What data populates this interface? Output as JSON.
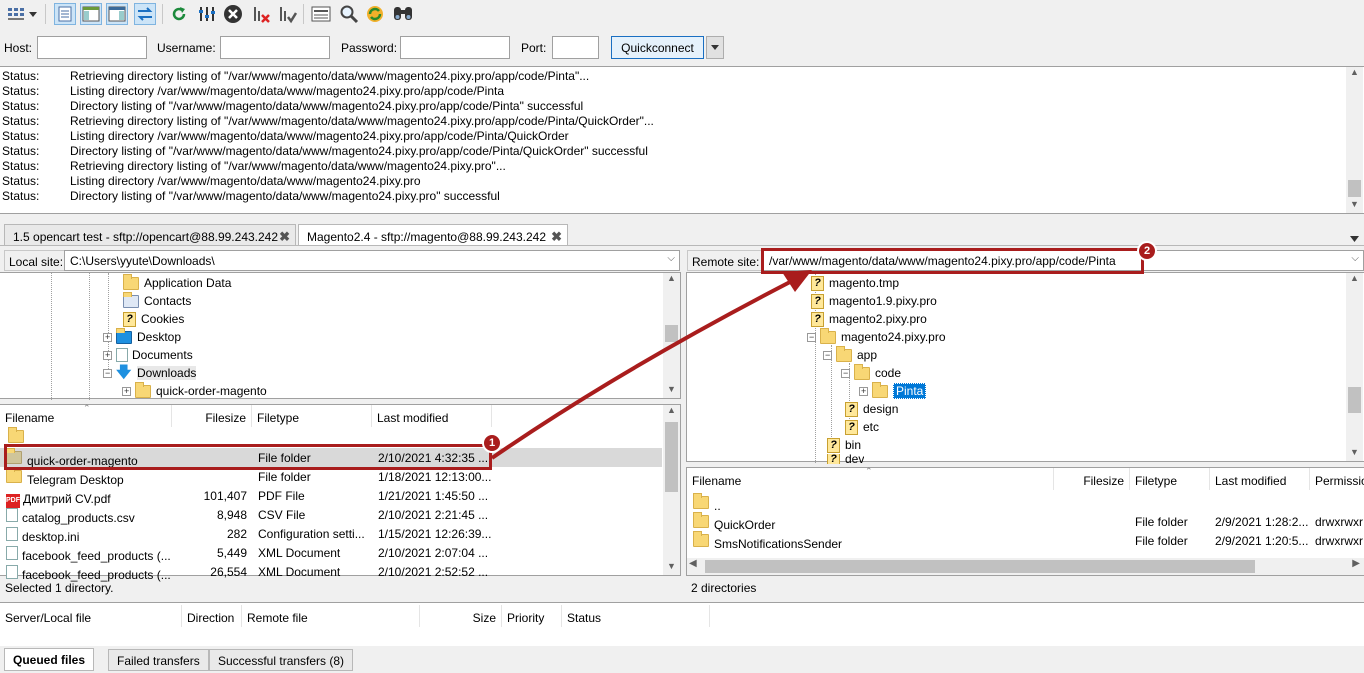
{
  "toolbar": {
    "icons": [
      "site-manager-icon",
      "dropdown-arrow-icon",
      "toggle-message-log-icon",
      "toggle-local-tree-icon",
      "toggle-remote-tree-icon",
      "toggle-queue-icon",
      "refresh-icon",
      "process-queue-icon",
      "cancel-icon",
      "disconnect-icon",
      "reconnect-icon",
      "directory-filter-icon",
      "search-icon",
      "sync-browse-icon",
      "compare-icon"
    ]
  },
  "quickconnect": {
    "host_label": "Host:",
    "username_label": "Username:",
    "password_label": "Password:",
    "port_label": "Port:",
    "host_value": "",
    "username_value": "",
    "password_value": "",
    "port_value": "",
    "button_label": "Quickconnect"
  },
  "message_log": [
    {
      "k": "Status:",
      "v": "Retrieving directory listing of \"/var/www/magento/data/www/magento24.pixy.pro/app/code/Pinta\"..."
    },
    {
      "k": "Status:",
      "v": "Listing directory /var/www/magento/data/www/magento24.pixy.pro/app/code/Pinta"
    },
    {
      "k": "Status:",
      "v": "Directory listing of \"/var/www/magento/data/www/magento24.pixy.pro/app/code/Pinta\" successful"
    },
    {
      "k": "Status:",
      "v": "Retrieving directory listing of \"/var/www/magento/data/www/magento24.pixy.pro/app/code/Pinta/QuickOrder\"..."
    },
    {
      "k": "Status:",
      "v": "Listing directory /var/www/magento/data/www/magento24.pixy.pro/app/code/Pinta/QuickOrder"
    },
    {
      "k": "Status:",
      "v": "Directory listing of \"/var/www/magento/data/www/magento24.pixy.pro/app/code/Pinta/QuickOrder\" successful"
    },
    {
      "k": "Status:",
      "v": "Retrieving directory listing of \"/var/www/magento/data/www/magento24.pixy.pro\"..."
    },
    {
      "k": "Status:",
      "v": "Listing directory /var/www/magento/data/www/magento24.pixy.pro"
    },
    {
      "k": "Status:",
      "v": "Directory listing of \"/var/www/magento/data/www/magento24.pixy.pro\" successful"
    }
  ],
  "tabs": [
    {
      "label": "1.5 opencart test - sftp://opencart@88.99.243.242"
    },
    {
      "label": "Magento2.4 - sftp://magento@88.99.243.242"
    }
  ],
  "local": {
    "site_label": "Local site:",
    "site_path": "C:\\Users\\yyute\\Downloads\\",
    "tree": [
      "Application Data",
      "Contacts",
      "Cookies",
      "Desktop",
      "Documents",
      "Downloads",
      "quick-order-magento"
    ],
    "headers": {
      "name": "Filename",
      "size": "Filesize",
      "type": "Filetype",
      "modified": "Last modified"
    },
    "files": [
      {
        "name": "quick-order-magento",
        "size": "",
        "type": "File folder",
        "modified": "2/10/2021 4:32:35 ..."
      },
      {
        "name": "Telegram Desktop",
        "size": "",
        "type": "File folder",
        "modified": "1/18/2021 12:13:00..."
      },
      {
        "name": "Дмитрий CV.pdf",
        "size": "101,407",
        "type": "PDF File",
        "modified": "1/21/2021 1:45:50 ..."
      },
      {
        "name": "catalog_products.csv",
        "size": "8,948",
        "type": "CSV File",
        "modified": "2/10/2021 2:21:45 ..."
      },
      {
        "name": "desktop.ini",
        "size": "282",
        "type": "Configuration setti...",
        "modified": "1/15/2021 12:26:39..."
      },
      {
        "name": "facebook_feed_products (...",
        "size": "5,449",
        "type": "XML Document",
        "modified": "2/10/2021 2:07:04 ..."
      },
      {
        "name": "facebook_feed_products (...",
        "size": "26,554",
        "type": "XML Document",
        "modified": "2/10/2021 2:52:52 ..."
      }
    ],
    "status": "Selected 1 directory."
  },
  "remote": {
    "site_label": "Remote site:",
    "site_path": "/var/www/magento/data/www/magento24.pixy.pro/app/code/Pinta",
    "tree": [
      "magento.tmp",
      "magento1.9.pixy.pro",
      "magento2.pixy.pro",
      "magento24.pixy.pro",
      "app",
      "code",
      "Pinta",
      "design",
      "etc",
      "bin",
      "dev"
    ],
    "headers": {
      "name": "Filename",
      "size": "Filesize",
      "type": "Filetype",
      "modified": "Last modified",
      "perm": "Permissions"
    },
    "files": [
      {
        "name": "..",
        "type": "",
        "modified": "",
        "perm": ""
      },
      {
        "name": "QuickOrder",
        "type": "File folder",
        "modified": "2/9/2021 1:28:2...",
        "perm": "drwxrwxr-x"
      },
      {
        "name": "SmsNotificationsSender",
        "type": "File folder",
        "modified": "2/9/2021 1:20:5...",
        "perm": "drwxrwxr-x"
      }
    ],
    "status": "2 directories"
  },
  "queue": {
    "headers": {
      "file": "Server/Local file",
      "direction": "Direction",
      "remote": "Remote file",
      "size": "Size",
      "priority": "Priority",
      "status": "Status"
    },
    "tabs": [
      "Queued files",
      "Failed transfers",
      "Successful transfers (8)"
    ]
  },
  "annotations": {
    "badge1": "1",
    "badge2": "2",
    "color": "#a91d1d"
  }
}
